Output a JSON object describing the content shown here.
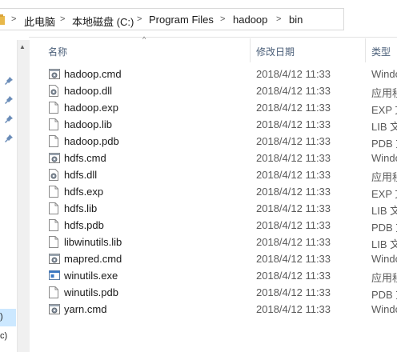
{
  "breadcrumb": {
    "items": [
      "此电脑",
      "本地磁盘 (C:)",
      "Program Files",
      "hadoop",
      "bin"
    ]
  },
  "columns": {
    "name": "名称",
    "date": "修改日期",
    "type": "类型"
  },
  "nav": {
    "selected_text": ")",
    "below_text": "c)"
  },
  "files": [
    {
      "name": "hadoop.cmd",
      "date": "2018/4/12 11:33",
      "type": "Windo",
      "icon": "cmd-gear-icon"
    },
    {
      "name": "hadoop.dll",
      "date": "2018/4/12 11:33",
      "type": "应用程",
      "icon": "dll-gear-icon"
    },
    {
      "name": "hadoop.exp",
      "date": "2018/4/12 11:33",
      "type": "EXP 文",
      "icon": "file-icon"
    },
    {
      "name": "hadoop.lib",
      "date": "2018/4/12 11:33",
      "type": "LIB 文",
      "icon": "file-icon"
    },
    {
      "name": "hadoop.pdb",
      "date": "2018/4/12 11:33",
      "type": "PDB 文",
      "icon": "file-icon"
    },
    {
      "name": "hdfs.cmd",
      "date": "2018/4/12 11:33",
      "type": "Windo",
      "icon": "cmd-gear-icon"
    },
    {
      "name": "hdfs.dll",
      "date": "2018/4/12 11:33",
      "type": "应用程",
      "icon": "dll-gear-icon"
    },
    {
      "name": "hdfs.exp",
      "date": "2018/4/12 11:33",
      "type": "EXP 文",
      "icon": "file-icon"
    },
    {
      "name": "hdfs.lib",
      "date": "2018/4/12 11:33",
      "type": "LIB 文",
      "icon": "file-icon"
    },
    {
      "name": "hdfs.pdb",
      "date": "2018/4/12 11:33",
      "type": "PDB 文",
      "icon": "file-icon"
    },
    {
      "name": "libwinutils.lib",
      "date": "2018/4/12 11:33",
      "type": "LIB 文",
      "icon": "file-icon"
    },
    {
      "name": "mapred.cmd",
      "date": "2018/4/12 11:33",
      "type": "Windo",
      "icon": "cmd-gear-icon"
    },
    {
      "name": "winutils.exe",
      "date": "2018/4/12 11:33",
      "type": "应用程",
      "icon": "exe-window-icon"
    },
    {
      "name": "winutils.pdb",
      "date": "2018/4/12 11:33",
      "type": "PDB 文",
      "icon": "file-icon"
    },
    {
      "name": "yarn.cmd",
      "date": "2018/4/12 11:33",
      "type": "Windo",
      "icon": "cmd-gear-icon"
    }
  ]
}
